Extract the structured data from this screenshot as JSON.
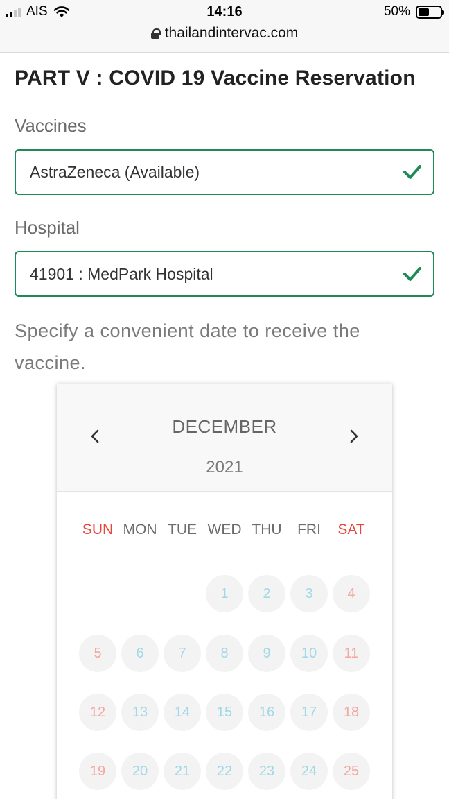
{
  "status_bar": {
    "carrier": "AIS",
    "time": "14:16",
    "battery_percent": "50%",
    "battery_level": 0.5,
    "url": "thailandintervac.com"
  },
  "form": {
    "title": "PART V : COVID 19 Vaccine Reservation",
    "vaccines_label": "Vaccines",
    "vaccines_value": "AstraZeneca (Available)",
    "hospital_label": "Hospital",
    "hospital_value": "41901 : MedPark Hospital",
    "date_prompt": "Specify a convenient date to receive the vaccine.",
    "valid_color": "#1e8a57"
  },
  "calendar": {
    "month": "DECEMBER",
    "year": "2021",
    "weekdays": [
      "SUN",
      "MON",
      "TUE",
      "WED",
      "THU",
      "FRI",
      "SAT"
    ],
    "first_weekday_index": 3,
    "days": [
      1,
      2,
      3,
      4,
      5,
      6,
      7,
      8,
      9,
      10,
      11,
      12,
      13,
      14,
      15,
      16,
      17,
      18,
      19,
      20,
      21,
      22,
      23,
      24,
      25
    ],
    "weekend_color": "#e8443a",
    "day_color": "#9fd8e6"
  }
}
